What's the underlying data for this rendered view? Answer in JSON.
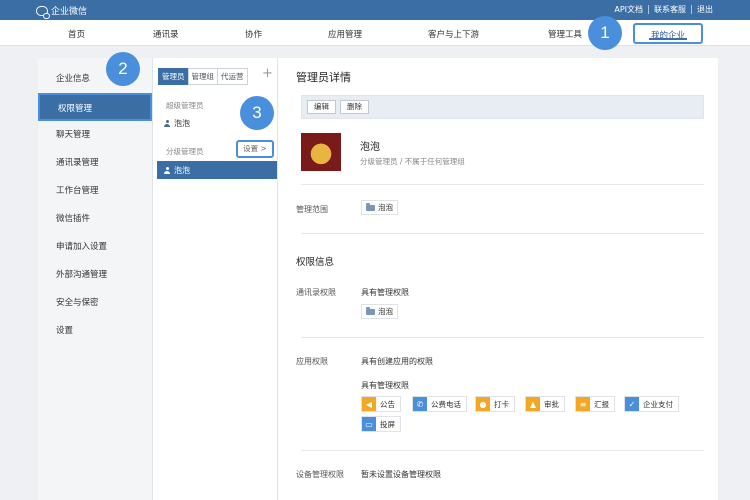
{
  "topbar": {
    "app_name": "企业微信",
    "links": [
      "API文档",
      "联系客服",
      "退出"
    ]
  },
  "nav": {
    "items": [
      "首页",
      "通讯录",
      "协作",
      "应用管理",
      "客户与上下游",
      "管理工具",
      "我的企业"
    ]
  },
  "callouts": [
    "1",
    "2",
    "3"
  ],
  "leftnav": {
    "items": [
      "企业信息",
      "权限管理",
      "聊天管理",
      "通讯录管理",
      "工作台管理",
      "微信插件",
      "申请加入设置",
      "外部沟通管理",
      "安全与保密",
      "设置"
    ]
  },
  "admin_list": {
    "tabs": [
      "管理员",
      "管理组",
      "代运营"
    ],
    "add": "+",
    "super_label": "超级管理员",
    "super_member": "泡泡",
    "sub_label": "分级管理员",
    "setting_button": "设置 >",
    "sub_member": "泡泡"
  },
  "detail": {
    "title": "管理员详情",
    "edit": "编辑",
    "delete": "删除",
    "name": "泡泡",
    "subtitle": "分级管理员 / 不属于任何管理组",
    "scope_label": "管理范围",
    "scope_value": "泡泡",
    "perm_title": "权限信息",
    "contacts_label": "通讯录权限",
    "contacts_value": "具有管理权限",
    "contacts_chip": "泡泡",
    "app_label": "应用权限",
    "app_create": "具有创建应用的权限",
    "app_manage": "具有管理权限",
    "apps": [
      {
        "name": "公告",
        "icon": "megaphone-icon",
        "color": "#f5a623",
        "glyph": "📢"
      },
      {
        "name": "公费电话",
        "icon": "phone-icon",
        "color": "#4a8fdc",
        "glyph": "✆"
      },
      {
        "name": "打卡",
        "icon": "location-icon",
        "color": "#f5a623",
        "glyph": "⚲"
      },
      {
        "name": "审批",
        "icon": "approval-icon",
        "color": "#f5a623",
        "glyph": "⚑"
      },
      {
        "name": "汇报",
        "icon": "report-icon",
        "color": "#f5a623",
        "glyph": "≡"
      },
      {
        "name": "企业支付",
        "icon": "payment-icon",
        "color": "#4a8fdc",
        "glyph": "✓"
      },
      {
        "name": "投屏",
        "icon": "screen-cast-icon",
        "color": "#4a8fdc",
        "glyph": "▭"
      }
    ],
    "device_label": "设备管理权限",
    "device_value": "暂未设置设备管理权限"
  },
  "colors": {
    "accent": "#3a6ea5",
    "callout": "#4a8fdc"
  }
}
